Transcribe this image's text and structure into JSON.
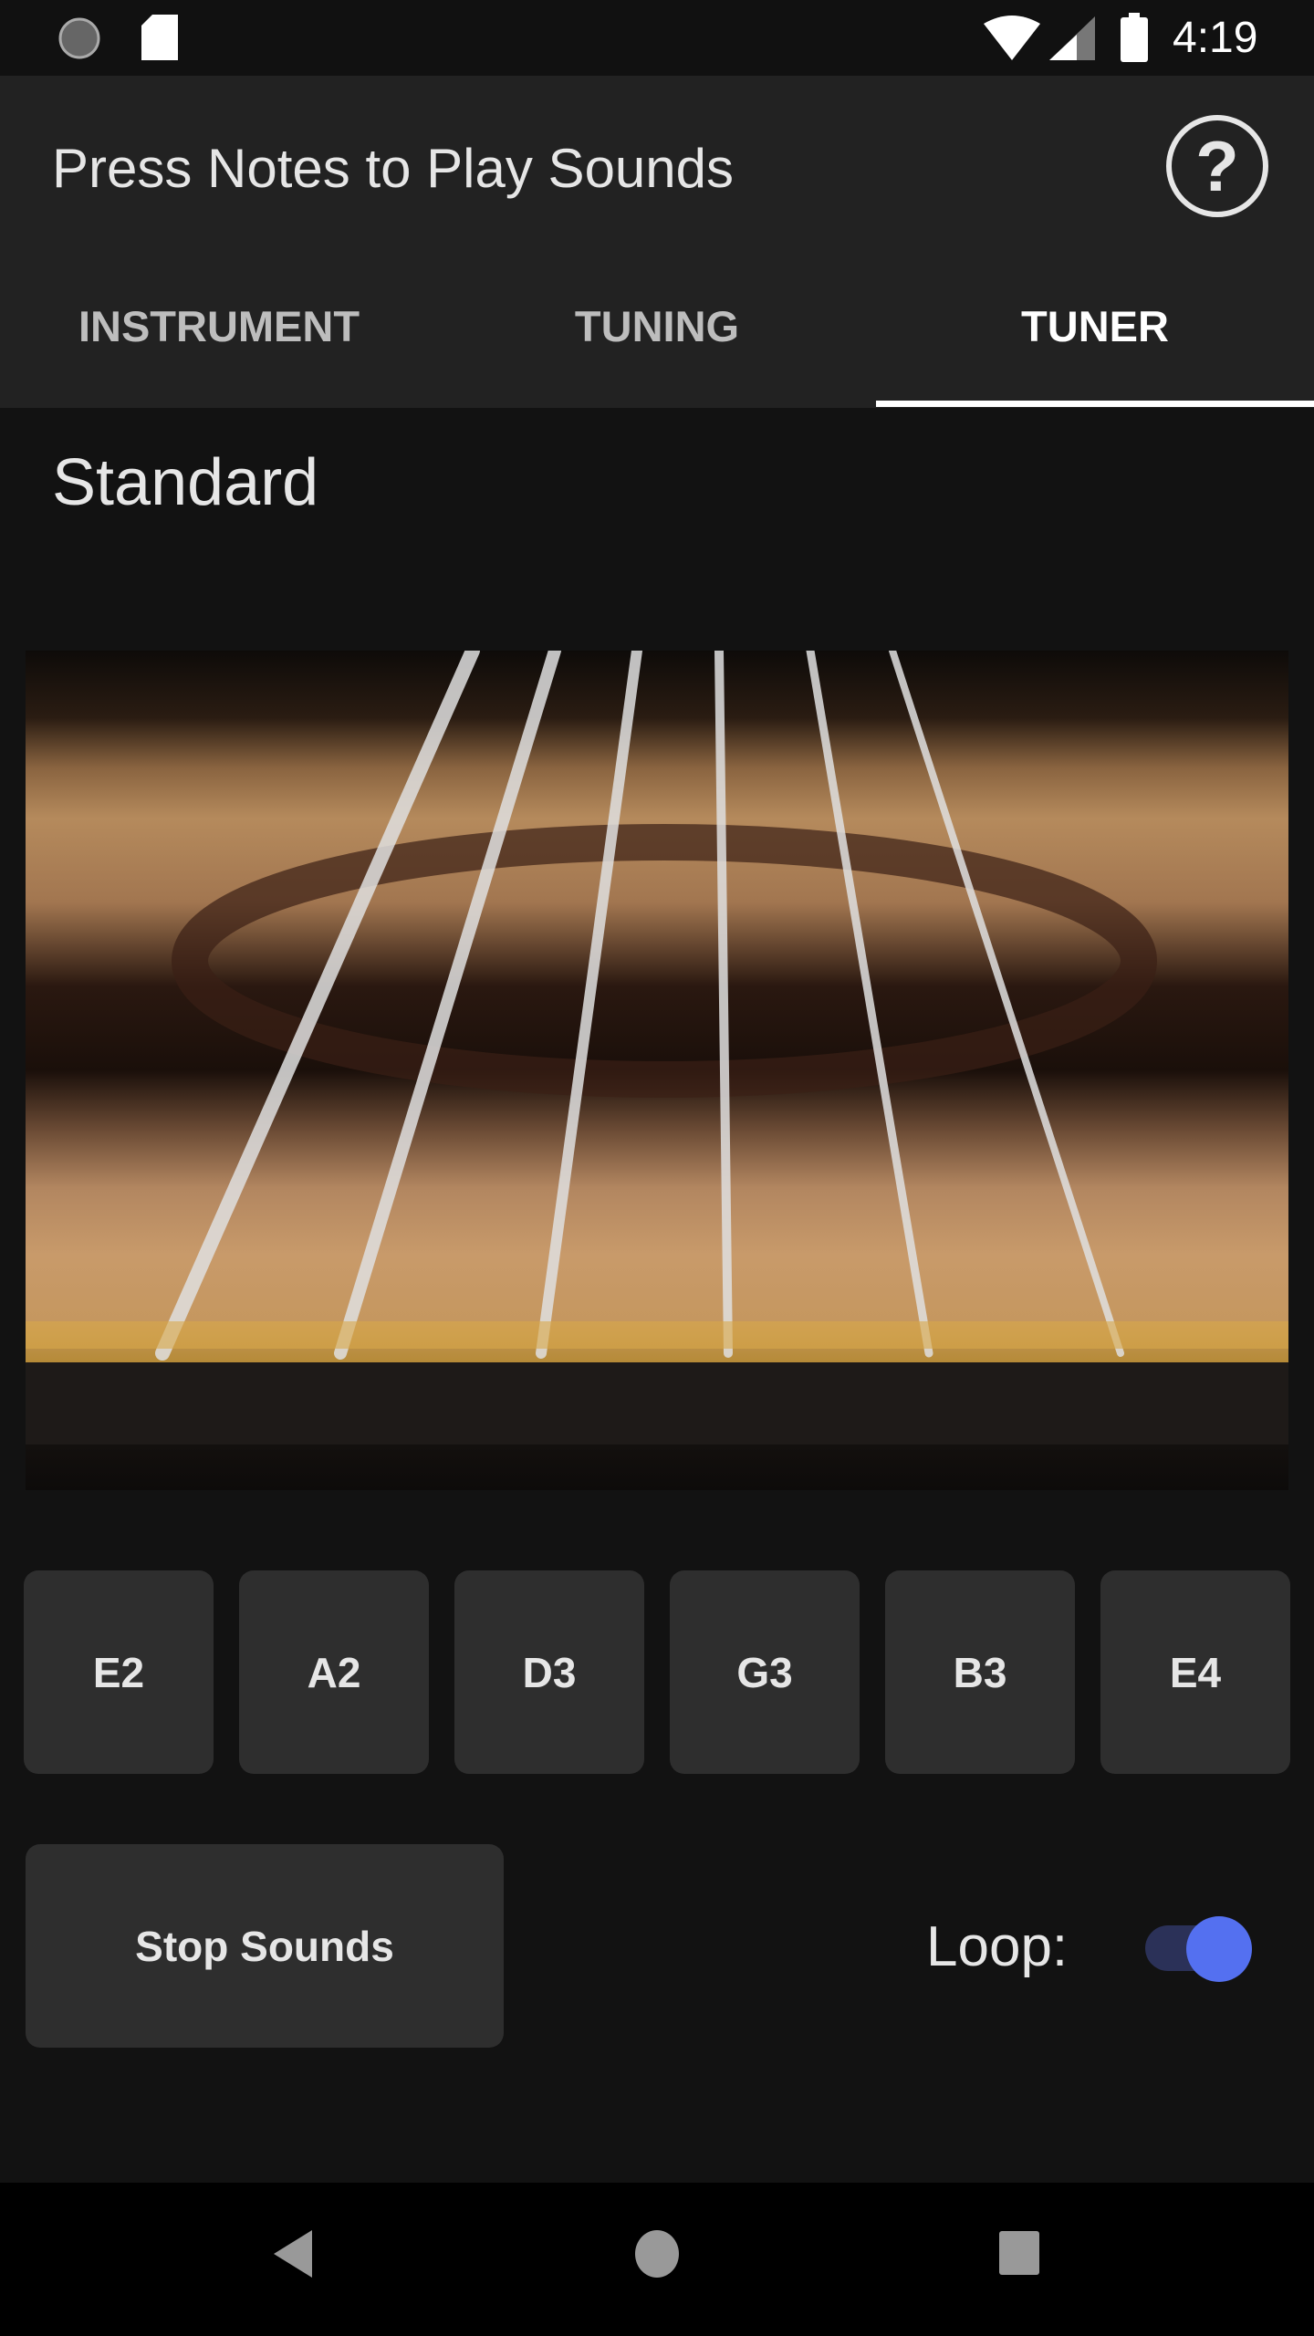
{
  "status_bar": {
    "time": "4:19",
    "icons": [
      "sync-icon",
      "sd-card-icon",
      "wifi-icon",
      "signal-icon",
      "battery-icon"
    ]
  },
  "app_bar": {
    "title": "Press Notes to Play Sounds",
    "help_icon": "help-circle-icon"
  },
  "tabs": [
    {
      "label": "INSTRUMENT",
      "active": false
    },
    {
      "label": "TUNING",
      "active": false
    },
    {
      "label": "TUNER",
      "active": true
    }
  ],
  "tuning_name": "Standard",
  "notes": [
    "E2",
    "A2",
    "D3",
    "G3",
    "B3",
    "E4"
  ],
  "stop_label": "Stop Sounds",
  "loop": {
    "label": "Loop:",
    "on": true
  },
  "colors": {
    "accent": "#5470f0",
    "appbar": "#222222",
    "background": "#121212",
    "button": "#2e2e2e"
  },
  "nav": [
    "back-icon",
    "home-icon",
    "recents-icon"
  ]
}
